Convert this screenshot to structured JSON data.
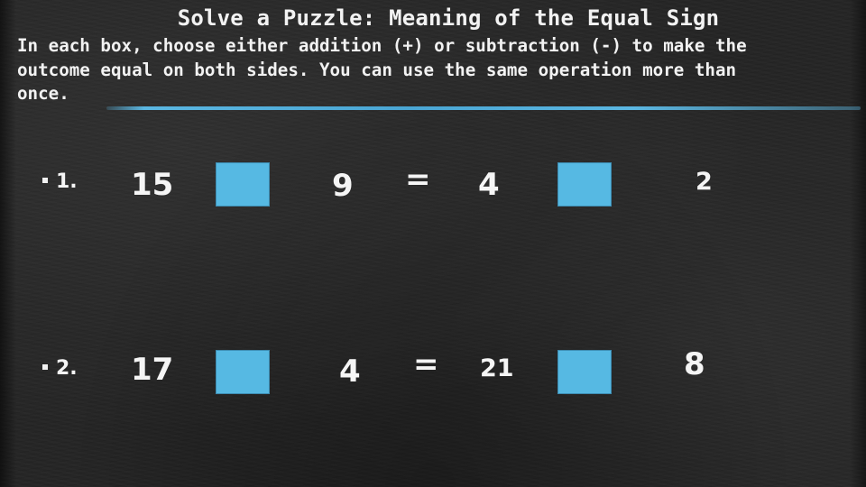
{
  "title": "Solve a Puzzle: Meaning of the Equal Sign",
  "instructions": "In each box, choose either addition (+) or subtraction (-) to make the\noutcome equal on both sides. You can use the same operation more than\nonce.",
  "accent_color": "#56b9e3",
  "problems": [
    {
      "label": "1.",
      "left_a": "15",
      "left_b": "9",
      "equals": "=",
      "right_a": "4",
      "right_b": "2"
    },
    {
      "label": "2.",
      "left_a": "17",
      "left_b": "4",
      "equals": "=",
      "right_a": "21",
      "right_b": "8"
    }
  ]
}
